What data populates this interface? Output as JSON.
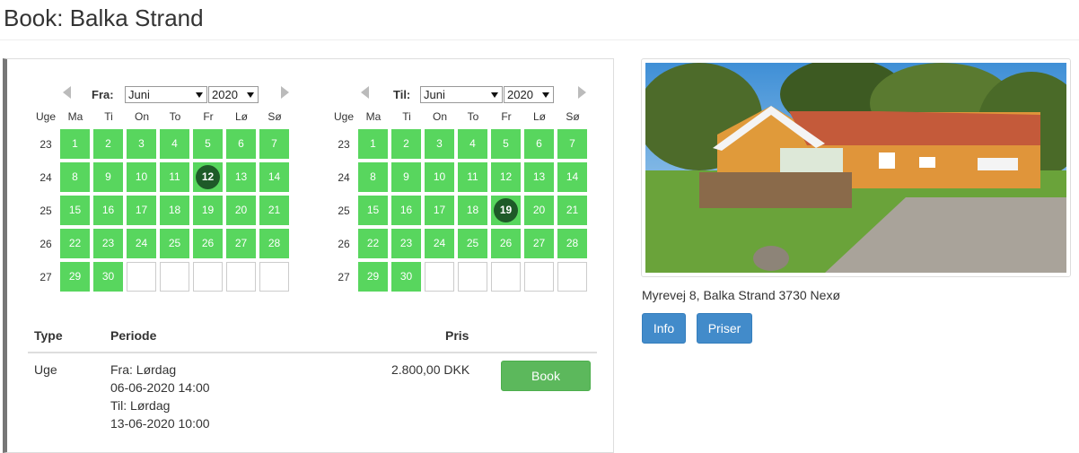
{
  "page": {
    "title": "Book: Balka Strand"
  },
  "calendar_from": {
    "label": "Fra:",
    "month": "Juni",
    "year": "2020",
    "selected_day": 12
  },
  "calendar_to": {
    "label": "Til:",
    "month": "Juni",
    "year": "2020",
    "selected_day": 19
  },
  "calendar_common": {
    "week_header": "Uge",
    "days": [
      "Ma",
      "Ti",
      "On",
      "To",
      "Fr",
      "Lø",
      "Sø"
    ],
    "weeks": [
      {
        "week": "23",
        "days": [
          "1",
          "2",
          "3",
          "4",
          "5",
          "6",
          "7"
        ]
      },
      {
        "week": "24",
        "days": [
          "8",
          "9",
          "10",
          "11",
          "12",
          "13",
          "14"
        ]
      },
      {
        "week": "25",
        "days": [
          "15",
          "16",
          "17",
          "18",
          "19",
          "20",
          "21"
        ]
      },
      {
        "week": "26",
        "days": [
          "22",
          "23",
          "24",
          "25",
          "26",
          "27",
          "28"
        ]
      },
      {
        "week": "27",
        "days": [
          "29",
          "30",
          "",
          "",
          "",
          "",
          ""
        ]
      }
    ],
    "available_color": "#58d65e",
    "selected_color": "#1e5a28"
  },
  "table": {
    "headers": {
      "type": "Type",
      "period": "Periode",
      "price": "Pris"
    },
    "row": {
      "type": "Uge",
      "from_label": "Fra: Lørdag",
      "from_date": "06-06-2020 14:00",
      "to_label": "Til: Lørdag",
      "to_date": "13-06-2020 10:00",
      "price": "2.800,00 DKK",
      "book_label": "Book"
    }
  },
  "property": {
    "address": "Myrevej 8, Balka Strand 3730 Nexø",
    "info_label": "Info",
    "prices_label": "Priser"
  }
}
